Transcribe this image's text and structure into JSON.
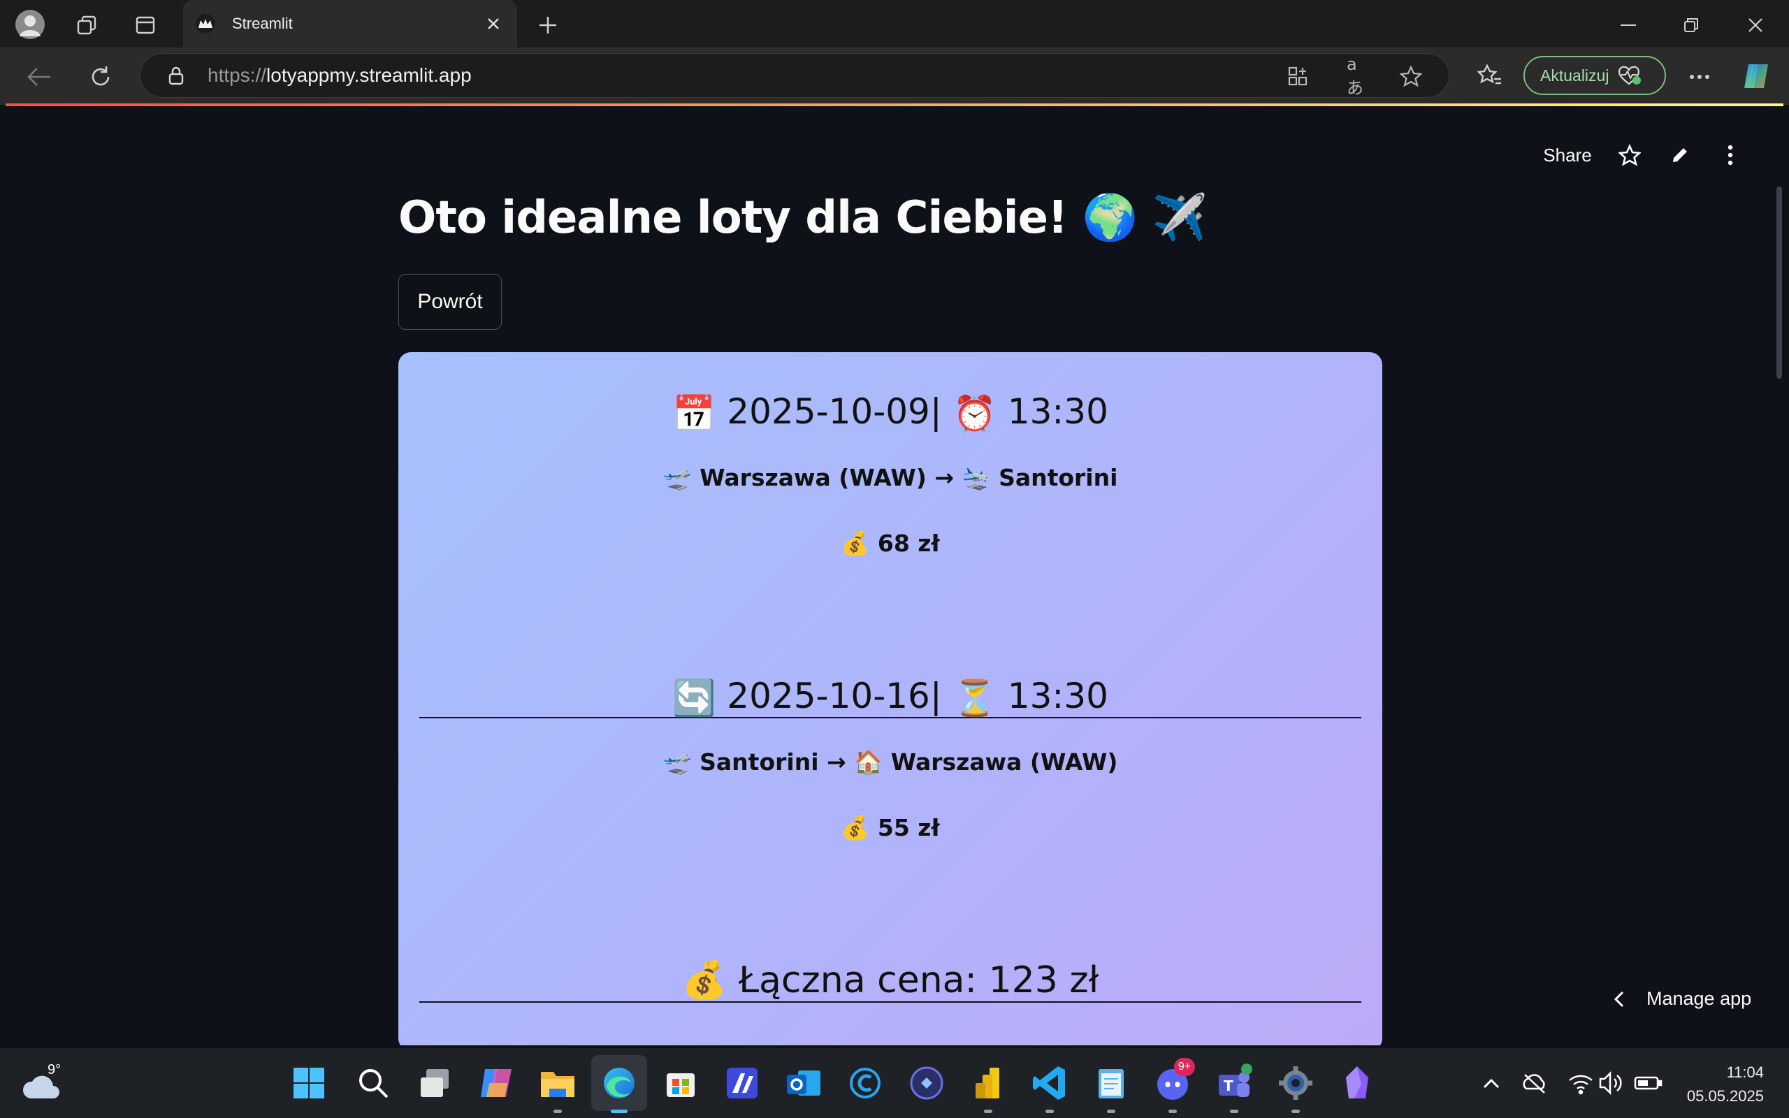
{
  "browser": {
    "tab_title": "Streamlit",
    "url_scheme": "https://",
    "url_host": "lotyappmy.streamlit.app",
    "update_label": "Aktualizuj"
  },
  "app_header": {
    "share_label": "Share"
  },
  "page": {
    "title": "Oto idealne loty dla Ciebie! 🌍 ✈️",
    "back_button": "Powrót"
  },
  "outbound": {
    "date_icon": "📅",
    "date": "2025-10-09",
    "sep": "|",
    "time_icon": "⏰",
    "time": "13:30",
    "from_icon": "🛫",
    "from": "Warszawa (WAW)",
    "arrow": "→",
    "to_icon": "🛬",
    "to": "Santorini",
    "price_icon": "💰",
    "price": "68 zł"
  },
  "return": {
    "date_icon": "🔄",
    "date": "2025-10-16",
    "sep": "|",
    "time_icon": "⏳",
    "time": "13:30",
    "from_icon": "🛫",
    "from": "Santorini",
    "arrow": "→",
    "to_icon": "🏠",
    "to": "Warszawa (WAW)",
    "price_icon": "💰",
    "price": "55 zł"
  },
  "total": {
    "icon": "💰",
    "label": "Łączna cena: 123 zł"
  },
  "manage_app": "Manage app",
  "taskbar": {
    "weather": "9°",
    "time": "11:04",
    "date": "05.05.2025",
    "discord_badge": "9+"
  },
  "colors": {
    "page_bg": "#0e1117",
    "card_gradient_start": "#a6c1fe",
    "card_gradient_end": "#bdaaf8",
    "update_accent": "#7dbd84"
  }
}
